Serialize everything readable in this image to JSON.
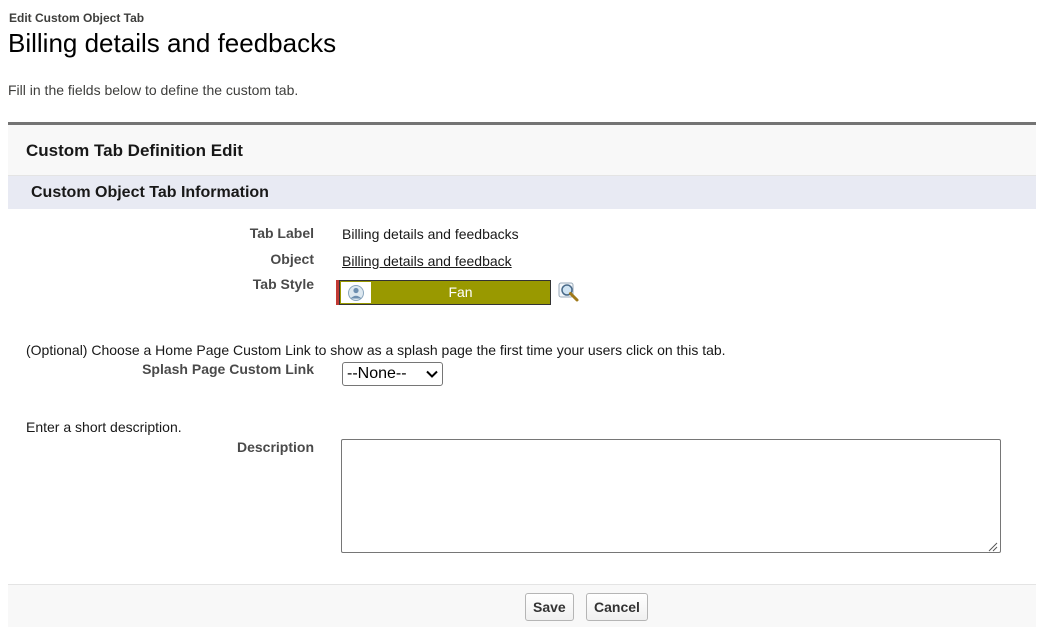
{
  "header": {
    "breadcrumb": "Edit Custom Object Tab",
    "title": "Billing details and feedbacks",
    "intro": "Fill in the fields below to define the custom tab."
  },
  "panel": {
    "title": "Custom Tab Definition Edit",
    "section_title": "Custom Object Tab Information"
  },
  "fields": {
    "tab_label": {
      "label": "Tab Label",
      "value": "Billing details and feedbacks"
    },
    "object": {
      "label": "Object",
      "value": "Billing details and feedback"
    },
    "tab_style": {
      "label": "Tab Style",
      "value": "Fan",
      "color": "#999900",
      "icon": "fan-icon"
    },
    "splash": {
      "help": "(Optional) Choose a Home Page Custom Link to show as a splash page the first time your users click on this tab.",
      "label": "Splash Page Custom Link",
      "selected": "--None--"
    },
    "description": {
      "help": "Enter a short description.",
      "label": "Description",
      "value": ""
    }
  },
  "buttons": {
    "save": "Save",
    "cancel": "Cancel"
  },
  "colors": {
    "required_marker": "#c23934",
    "section_header_bg": "#e8eaf3",
    "panel_border": "#747474"
  }
}
